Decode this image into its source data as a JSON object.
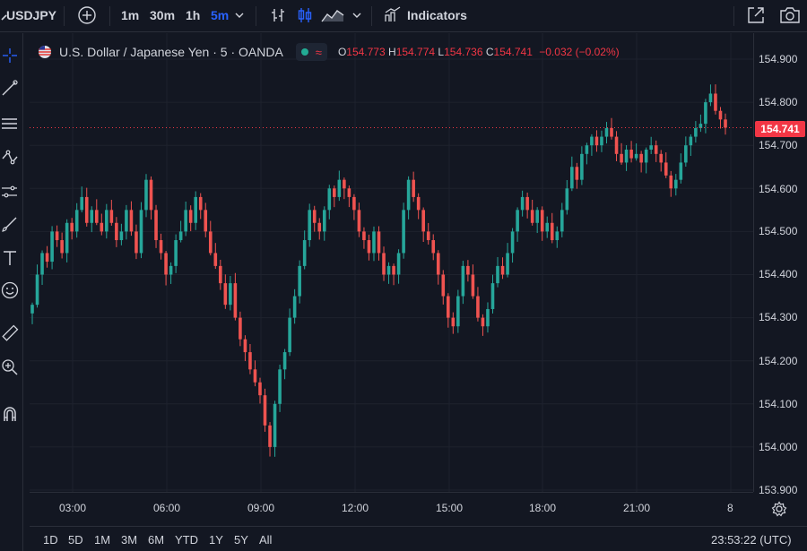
{
  "toolbar": {
    "symbol": "USDJPY",
    "intervals": [
      "1m",
      "30m",
      "1h",
      "5m"
    ],
    "active_interval": "5m",
    "indicators_label": "Indicators",
    "colors": {
      "active": "#2962ff"
    }
  },
  "legend": {
    "title": "U.S. Dollar / Japanese Yen · 5 · OANDA",
    "open_key": "O",
    "open": "154.773",
    "high_key": "H",
    "high": "154.774",
    "low_key": "L",
    "low": "154.736",
    "close_key": "C",
    "close": "154.741",
    "change": "−0.032 (−0.02%)"
  },
  "price_axis": {
    "ticks": [
      "154.900",
      "154.800",
      "154.700",
      "154.600",
      "154.500",
      "154.400",
      "154.300",
      "154.200",
      "154.100",
      "154.000",
      "153.900"
    ],
    "last_price": "154.741"
  },
  "time_axis": {
    "ticks": [
      "03:00",
      "06:00",
      "09:00",
      "12:00",
      "15:00",
      "18:00",
      "21:00",
      "8"
    ]
  },
  "bottom_bar": {
    "ranges": [
      "1D",
      "5D",
      "1M",
      "3M",
      "6M",
      "YTD",
      "1Y",
      "5Y",
      "All"
    ],
    "clock": "23:53:22 (UTC)"
  },
  "chart_data": {
    "type": "candlestick",
    "ylim": [
      153.9,
      154.9
    ],
    "last_price": 154.741,
    "colors": {
      "up": "#26a69a",
      "down": "#ef5350",
      "last_line": "#f23645"
    },
    "closes": [
      154.33,
      154.4,
      154.45,
      154.43,
      154.5,
      154.48,
      154.45,
      154.52,
      154.5,
      154.55,
      154.58,
      154.52,
      154.55,
      154.52,
      154.5,
      154.55,
      154.52,
      154.48,
      154.5,
      154.55,
      154.5,
      154.45,
      154.55,
      154.62,
      154.55,
      154.48,
      154.45,
      154.4,
      154.42,
      154.48,
      154.5,
      154.55,
      154.52,
      154.58,
      154.55,
      154.5,
      154.45,
      154.42,
      154.38,
      154.33,
      154.38,
      154.3,
      154.25,
      154.22,
      154.18,
      154.15,
      154.12,
      154.05,
      154.0,
      154.1,
      154.18,
      154.22,
      154.3,
      154.35,
      154.42,
      154.48,
      154.55,
      154.52,
      154.5,
      154.55,
      154.6,
      154.58,
      154.62,
      154.6,
      154.58,
      154.55,
      154.5,
      154.48,
      154.45,
      154.5,
      154.45,
      154.4,
      154.42,
      154.4,
      154.45,
      154.55,
      154.62,
      154.58,
      154.55,
      154.5,
      154.48,
      154.45,
      154.4,
      154.35,
      154.3,
      154.28,
      154.35,
      154.42,
      154.4,
      154.35,
      154.3,
      154.28,
      154.32,
      154.38,
      154.42,
      154.4,
      154.45,
      154.5,
      154.55,
      154.58,
      154.55,
      154.52,
      154.55,
      154.5,
      154.52,
      154.48,
      154.5,
      154.55,
      154.6,
      154.65,
      154.62,
      154.68,
      154.7,
      154.72,
      154.7,
      154.72,
      154.74,
      154.72,
      154.68,
      154.66,
      154.69,
      154.67,
      154.68,
      154.66,
      154.69,
      154.7,
      154.68,
      154.66,
      154.63,
      154.6,
      154.62,
      154.66,
      154.7,
      154.72,
      154.74,
      154.75,
      154.8,
      154.82,
      154.78,
      154.76,
      154.741
    ]
  }
}
